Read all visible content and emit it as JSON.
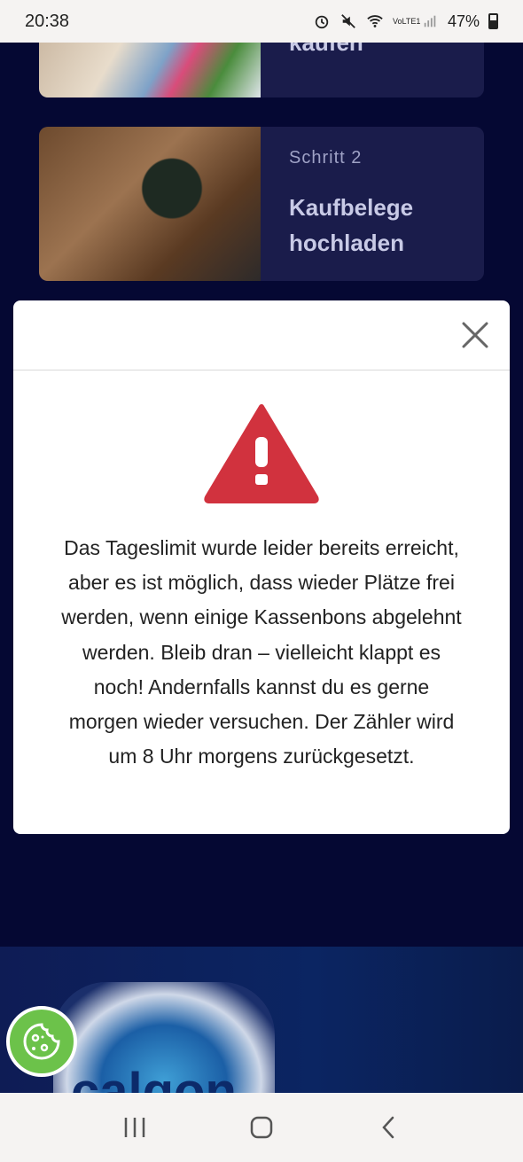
{
  "status_bar": {
    "time": "20:38",
    "battery": "47%",
    "icons": [
      "alarm-icon",
      "mute-icon",
      "wifi-icon",
      "volte-icon",
      "signal-icon",
      "battery-icon"
    ],
    "volte_label": "VoLTE1"
  },
  "steps": [
    {
      "title": "kaufen"
    },
    {
      "label": "Schritt 2",
      "title_line1": "Kaufbelege",
      "title_line2": "hochladen"
    }
  ],
  "modal": {
    "message": "Das Tageslimit wurde leider bereits erreicht, aber es ist möglich, dass wieder Plätze frei werden, wenn einige Kassenbons abgelehnt werden. Bleib dran – vielleicht klappt es noch! Andernfalls kannst du es gerne morgen wieder versuchen. Der Zähler wird um 8 Uhr morgens zurückgesetzt.",
    "icon": "warning-icon",
    "close_icon": "close-icon"
  },
  "promo": {
    "logo_text": "calgon"
  },
  "colors": {
    "page_bg": "#050833",
    "card_bg": "#1a1c4b",
    "warning_red": "#d1323e",
    "cookie_green": "#6cc24a"
  },
  "nav": {
    "icons": [
      "recent-apps-icon",
      "home-icon",
      "back-icon"
    ]
  }
}
